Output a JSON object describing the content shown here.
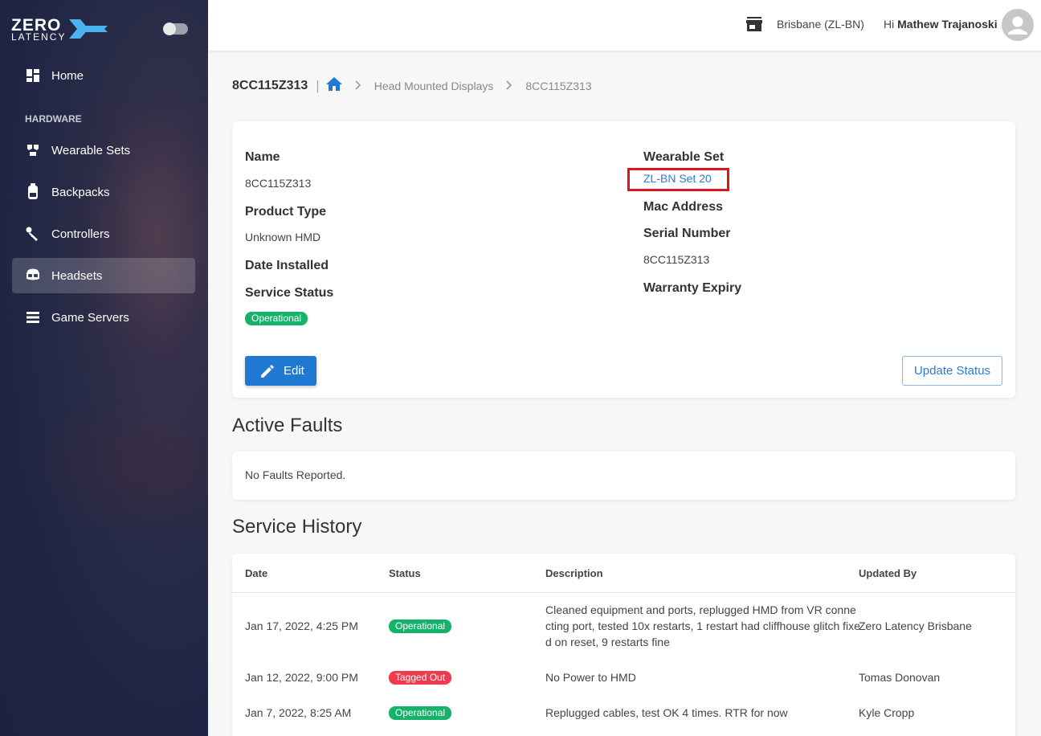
{
  "brand": {
    "line1": "ZERO",
    "line2": "LATENCY"
  },
  "sidebar": {
    "section_label": "HARDWARE",
    "items": [
      {
        "label": "Home",
        "icon": "dashboard-icon"
      },
      {
        "label": "Wearable Sets",
        "icon": "wearable-icon"
      },
      {
        "label": "Backpacks",
        "icon": "backpack-icon"
      },
      {
        "label": "Controllers",
        "icon": "controller-icon"
      },
      {
        "label": "Headsets",
        "icon": "headset-icon",
        "active": true
      },
      {
        "label": "Game Servers",
        "icon": "server-icon"
      }
    ]
  },
  "header": {
    "location": "Brisbane (ZL-BN)",
    "greeting_prefix": "Hi ",
    "user_name": "Mathew Trajanoski"
  },
  "breadcrumb": {
    "title": "8CC115Z313",
    "separator": "|",
    "items": [
      "Head Mounted Displays",
      "8CC115Z313"
    ]
  },
  "details": {
    "name_label": "Name",
    "name_value": "8CC115Z313",
    "product_type_label": "Product Type",
    "product_type_value": "Unknown HMD",
    "date_installed_label": "Date Installed",
    "service_status_label": "Service Status",
    "service_status_value": "Operational",
    "wearable_set_label": "Wearable Set",
    "wearable_set_value": "ZL-BN Set 20",
    "mac_label": "Mac Address",
    "serial_label": "Serial Number",
    "serial_value": "8CC115Z313",
    "warranty_label": "Warranty Expiry",
    "edit_label": "Edit",
    "update_status_label": "Update Status"
  },
  "active_faults": {
    "title": "Active Faults",
    "empty_text": "No Faults Reported."
  },
  "service_history": {
    "title": "Service History",
    "columns": [
      "Date",
      "Status",
      "Description",
      "Updated By"
    ],
    "rows": [
      {
        "date": "Jan 17, 2022, 4:25 PM",
        "status": "Operational",
        "description": "Cleaned equipment and ports, replugged HMD from VR connecting port, tested 10x restarts, 1 restart had cliffhouse glitch fixed on reset, 9 restarts fine",
        "updated_by": "Zero Latency Brisbane"
      },
      {
        "date": "Jan 12, 2022, 9:00 PM",
        "status": "Tagged Out",
        "description": "No Power to HMD",
        "updated_by": "Tomas Donovan"
      },
      {
        "date": "Jan 7, 2022, 8:25 AM",
        "status": "Operational",
        "description": "Replugged cables, test OK 4 times. RTR for now",
        "updated_by": "Kyle Cropp"
      }
    ]
  },
  "colors": {
    "accent": "#1f78d1",
    "operational": "#17b26a",
    "tagged_out": "#ef3b4d",
    "sidebar": "#1e2544"
  }
}
